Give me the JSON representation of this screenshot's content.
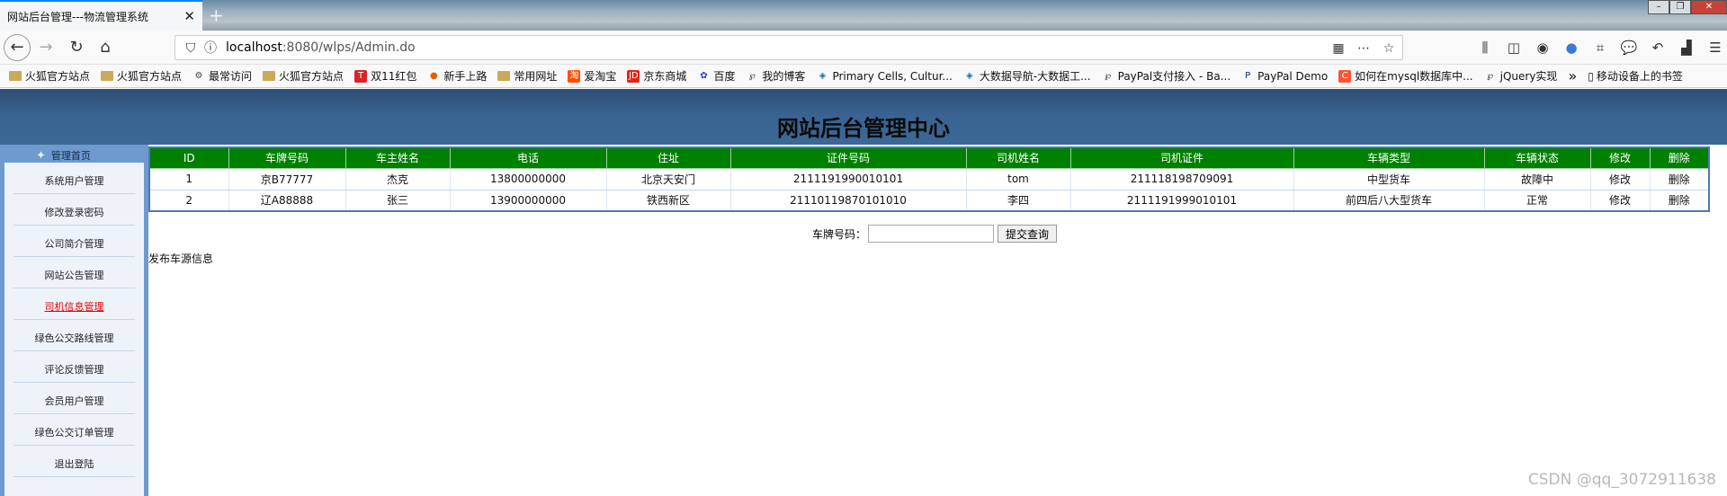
{
  "browser": {
    "tab_title": "网站后台管理---物流管理系统",
    "tab_close": "✕",
    "new_tab": "+",
    "url_host": "localhost",
    "url_rest": ":8080/wlps/Admin.do",
    "bookmarks": [
      {
        "label": "火狐官方站点",
        "icon": "folder-icon"
      },
      {
        "label": "火狐官方站点",
        "icon": "folder-icon"
      },
      {
        "label": "最常访问",
        "icon": "gear-icon"
      },
      {
        "label": "火狐官方站点",
        "icon": "folder-icon"
      },
      {
        "label": "双11红包",
        "icon": "tmall-icon"
      },
      {
        "label": "新手上路",
        "icon": "firefox-icon"
      },
      {
        "label": "常用网址",
        "icon": "folder-icon"
      },
      {
        "label": "爱淘宝",
        "icon": "taobao-icon"
      },
      {
        "label": "京东商城",
        "icon": "jd-icon"
      },
      {
        "label": "百度",
        "icon": "baidu-icon"
      },
      {
        "label": "我的博客",
        "icon": "blog-icon"
      },
      {
        "label": "Primary Cells, Cultur...",
        "icon": "site-icon"
      },
      {
        "label": "大数据导航-大数据工...",
        "icon": "site-icon"
      },
      {
        "label": "PayPal支付接入 - Ba...",
        "icon": "blog-icon"
      },
      {
        "label": "PayPal Demo",
        "icon": "paypal-icon"
      },
      {
        "label": "如何在mysql数据库中...",
        "icon": "csdn-icon"
      },
      {
        "label": "jQuery实现",
        "icon": "blog-icon"
      }
    ],
    "bookmarks_overflow": "»",
    "mobile_bookmarks": "移动设备上的书签"
  },
  "page": {
    "title": "网站后台管理中心"
  },
  "sidebar": {
    "head": "管理首页",
    "items": [
      {
        "label": "系统用户管理"
      },
      {
        "label": "修改登录密码"
      },
      {
        "label": "公司简介管理"
      },
      {
        "label": "网站公告管理"
      },
      {
        "label": "司机信息管理"
      },
      {
        "label": "绿色公交路线管理"
      },
      {
        "label": "评论反馈管理"
      },
      {
        "label": "会员用户管理"
      },
      {
        "label": "绿色公交订单管理"
      },
      {
        "label": "退出登陆"
      }
    ],
    "active_index": 4
  },
  "table": {
    "headers": [
      "ID",
      "车牌号码",
      "车主姓名",
      "电话",
      "住址",
      "证件号码",
      "司机姓名",
      "司机证件",
      "车辆类型",
      "车辆状态",
      "修改",
      "删除"
    ],
    "rows": [
      [
        "1",
        "京B77777",
        "杰克",
        "13800000000",
        "北京天安门",
        "2111191990010101",
        "tom",
        "211118198709091",
        "中型货车",
        "故障中",
        "修改",
        "删除"
      ],
      [
        "2",
        "辽A88888",
        "张三",
        "13900000000",
        "铁西新区",
        "2111011987010101​0",
        "李四",
        "2111191999010101",
        "前四后八大型货车",
        "正常",
        "修改",
        "删除"
      ]
    ]
  },
  "search": {
    "label": "车牌号码：",
    "value": "",
    "submit": "提交查询"
  },
  "publish_link": "发布车源信息",
  "watermark": "CSDN @qq_3072911638",
  "colors": {
    "header_bg": "#3a6493",
    "sidebar_bg": "#6e9ad0",
    "table_header_bg": "#008000",
    "active_link": "#e00000"
  }
}
